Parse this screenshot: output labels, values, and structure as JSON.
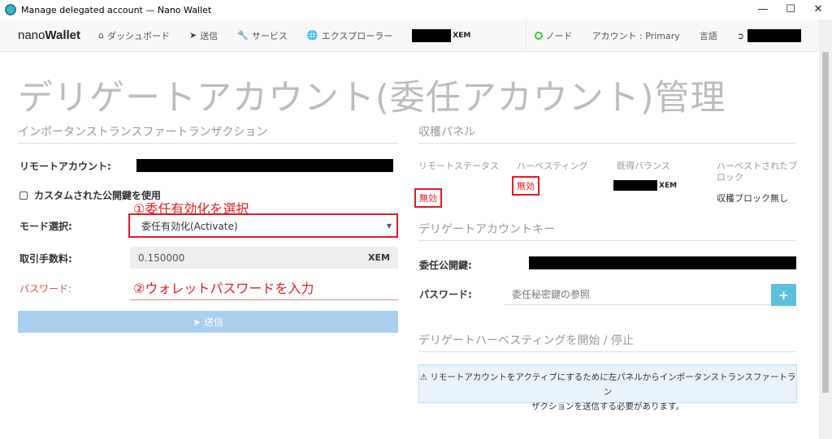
{
  "window": {
    "title": "Manage delegated account — Nano Wallet",
    "minimize": "—",
    "maximize": "☐",
    "close": "✕"
  },
  "nav": {
    "brand_prefix": "nano",
    "brand_bold": "Wallet",
    "dashboard": "ダッシュボード",
    "send": "送信",
    "services": "サービス",
    "explorer": "エクスプローラー",
    "balance_unit": "XEM",
    "node": "ノード",
    "account": "アカウント : Primary",
    "language": "言語"
  },
  "page": {
    "title": "デリゲートアカウント(委任アカウント)管理"
  },
  "left": {
    "section_title": "インポータンストランスファートランザクション",
    "remote_account_label": "リモートアカウント:",
    "custom_key_label": "カスタムされた公開鍵を使用",
    "annotation1": "①委任有効化を選択",
    "mode_label": "モード選択:",
    "mode_value": "委任有効化(Activate)",
    "fee_label": "取引手数料:",
    "fee_value": "0.150000",
    "fee_unit": "XEM",
    "password_label": "パスワード:",
    "annotation2": "②ウォレットパスワードを入力",
    "send_button": "送信"
  },
  "harvest": {
    "section_title": "収穫パネル",
    "col1_head": "リモートステータス",
    "col1_value": "無効",
    "col2_head": "ハーベスティング",
    "col2_value": "無効",
    "col3_head": "既得バランス",
    "col3_unit": "XEM",
    "col4_head": "ハーベストされたブロック",
    "col4_value": "収穫ブロック無し"
  },
  "delegate_key": {
    "section_title": "デリゲートアカウントキー",
    "pubkey_label": "委任公開鍵:",
    "password_label": "パスワード:",
    "password_placeholder": "委任秘密鍵の参照",
    "plus": "+"
  },
  "start_stop": {
    "section_title": "デリゲートハーベスティングを開始 / 停止",
    "alert_line1": "リモートアカウントをアクティブにするために左パネルからインポータンストランスファートラン",
    "alert_line2": "ザクションを送信する必要があります。"
  },
  "colors": {
    "annotation_red": "#e21b22",
    "status_red": "#d9534f",
    "send_button": "#a9cfee",
    "plus_button": "#5bc0de",
    "alert_bg": "#e8f3fb"
  },
  "icons": [
    "home-icon",
    "paper-plane-icon",
    "wrench-icon",
    "globe-icon",
    "circle-icon",
    "sign-out-icon",
    "warning-icon"
  ]
}
